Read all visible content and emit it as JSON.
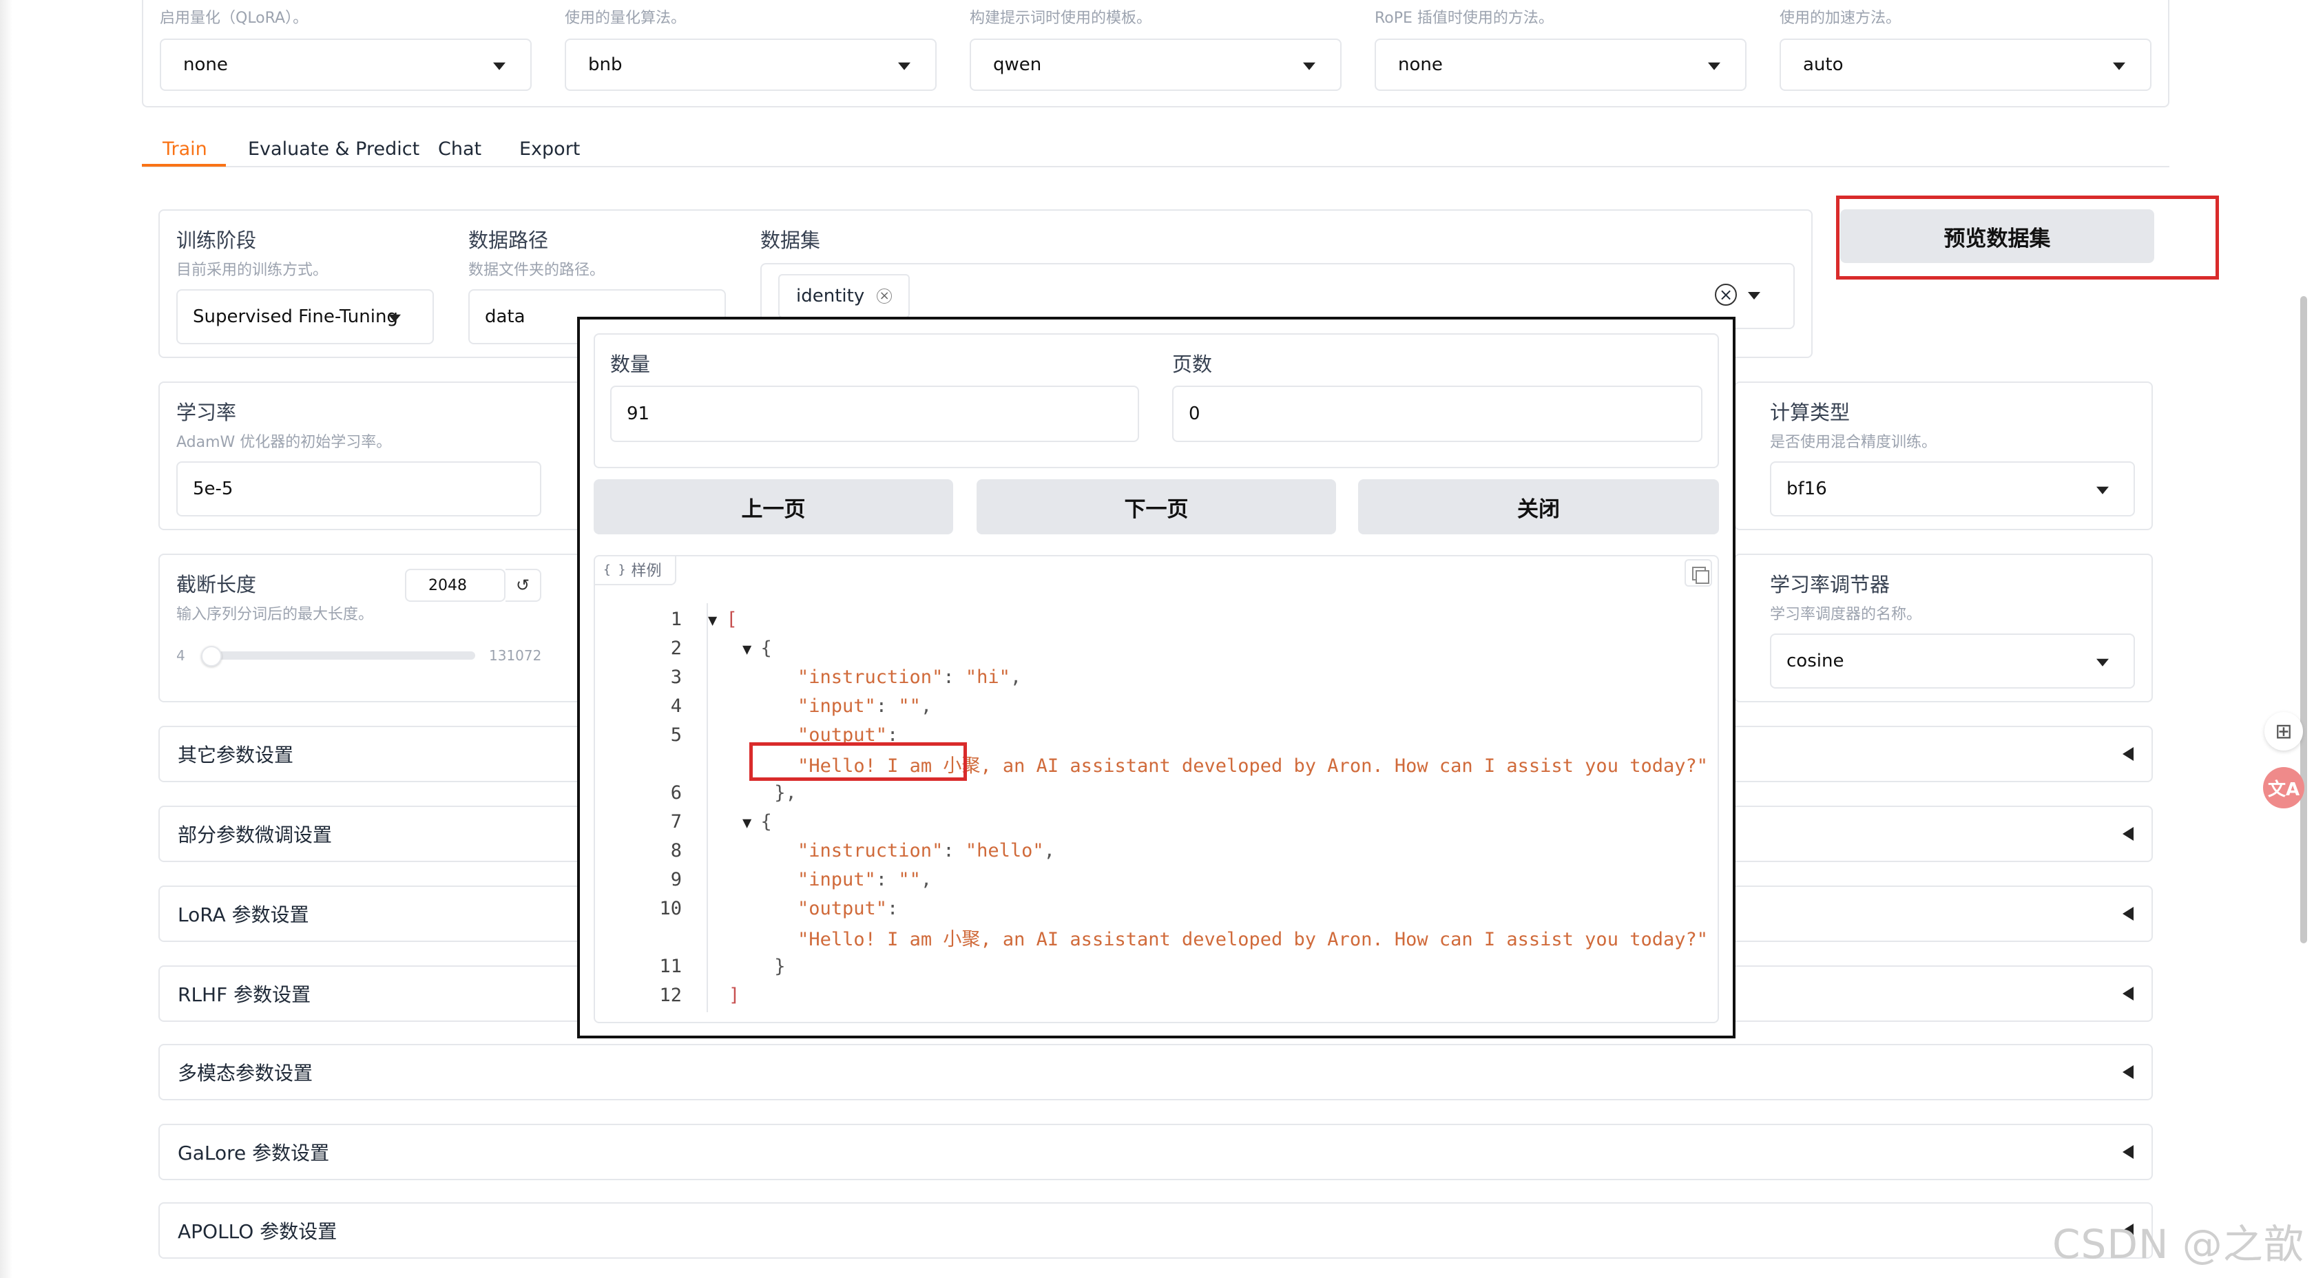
{
  "top": {
    "descs": [
      "启用量化（QLoRA）。",
      "使用的量化算法。",
      "构建提示词时使用的模板。",
      "RoPE 插值时使用的方法。",
      "使用的加速方法。"
    ],
    "selects": [
      "none",
      "bnb",
      "qwen",
      "none",
      "auto"
    ]
  },
  "tabs": [
    "Train",
    "Evaluate & Predict",
    "Chat",
    "Export"
  ],
  "train": {
    "stage_label": "训练阶段",
    "stage_desc": "目前采用的训练方式。",
    "stage_value": "Supervised Fine-Tuning",
    "dir_label": "数据路径",
    "dir_desc": "数据文件夹的路径。",
    "dir_value": "data",
    "dataset_label": "数据集",
    "dataset_chip": "identity",
    "preview_button": "预览数据集",
    "lr_label": "学习率",
    "lr_desc": "AdamW 优化器的初始学习率。",
    "lr_value": "5e-5",
    "compute_label": "计算类型",
    "compute_desc": "是否使用混合精度训练。",
    "compute_value": "bf16",
    "cutoff_label": "截断长度",
    "cutoff_desc": "输入序列分词后的最大长度。",
    "cutoff_value": "2048",
    "cutoff_min": "4",
    "cutoff_max": "131072",
    "sched_label": "学习率调节器",
    "sched_desc": "学习率调度器的名称。",
    "sched_value": "cosine"
  },
  "accordions": [
    "其它参数设置",
    "部分参数微调设置",
    "LoRA 参数设置",
    "RLHF 参数设置",
    "多模态参数设置",
    "GaLore 参数设置",
    "APOLLO 参数设置"
  ],
  "modal": {
    "count_label": "数量",
    "count_value": "91",
    "page_label": "页数",
    "page_value": "0",
    "prev_button": "上一页",
    "next_button": "下一页",
    "close_button": "关闭",
    "code_tag": "样例",
    "lines": [
      {
        "n": "1",
        "fold": true,
        "indent": 0,
        "parts": [
          [
            "br",
            "["
          ]
        ]
      },
      {
        "n": "2",
        "fold": true,
        "indent": 1,
        "parts": [
          [
            "p",
            "{"
          ]
        ]
      },
      {
        "n": "3",
        "fold": false,
        "indent": 2,
        "parts": [
          [
            "k",
            "\"instruction\""
          ],
          [
            "p",
            ": "
          ],
          [
            "k",
            "\"hi\""
          ],
          [
            "p",
            ","
          ]
        ]
      },
      {
        "n": "4",
        "fold": false,
        "indent": 2,
        "parts": [
          [
            "k",
            "\"input\""
          ],
          [
            "p",
            ": "
          ],
          [
            "k",
            "\"\""
          ],
          [
            "p",
            ","
          ]
        ]
      },
      {
        "n": "5",
        "fold": false,
        "indent": 2,
        "parts": [
          [
            "k",
            "\"output\""
          ],
          [
            "p",
            ":"
          ]
        ]
      },
      {
        "n": "",
        "fold": false,
        "indent": 2,
        "parts": [
          [
            "k",
            " \"Hello! I am 小聚, an AI assistant developed by Aron. How can I assist you today?\""
          ]
        ]
      },
      {
        "n": "6",
        "fold": false,
        "indent": 1,
        "parts": [
          [
            "p",
            " },"
          ]
        ]
      },
      {
        "n": "7",
        "fold": true,
        "indent": 1,
        "parts": [
          [
            "p",
            "{"
          ]
        ]
      },
      {
        "n": "8",
        "fold": false,
        "indent": 2,
        "parts": [
          [
            "k",
            "\"instruction\""
          ],
          [
            "p",
            ": "
          ],
          [
            "k",
            "\"hello\""
          ],
          [
            "p",
            ","
          ]
        ]
      },
      {
        "n": "9",
        "fold": false,
        "indent": 2,
        "parts": [
          [
            "k",
            "\"input\""
          ],
          [
            "p",
            ": "
          ],
          [
            "k",
            "\"\""
          ],
          [
            "p",
            ","
          ]
        ]
      },
      {
        "n": "10",
        "fold": false,
        "indent": 2,
        "parts": [
          [
            "k",
            "\"output\""
          ],
          [
            "p",
            ":"
          ]
        ]
      },
      {
        "n": "",
        "fold": false,
        "indent": 2,
        "parts": [
          [
            "k",
            " \"Hello! I am 小聚, an AI assistant developed by Aron. How can I assist you today?\""
          ]
        ]
      },
      {
        "n": "11",
        "fold": false,
        "indent": 1,
        "parts": [
          [
            "p",
            " }"
          ]
        ]
      },
      {
        "n": "12",
        "fold": false,
        "indent": 0,
        "parts": [
          [
            "br",
            "]"
          ]
        ]
      }
    ]
  },
  "watermark": "CSDN @之歆",
  "colors": {
    "accent": "#f97316",
    "highlight": "#d92b2b",
    "code_key": "#d06a3a"
  }
}
